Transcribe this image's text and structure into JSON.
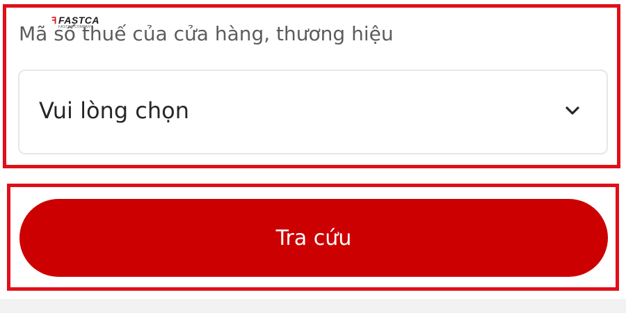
{
  "watermark": {
    "brand": "FASTCA",
    "tagline": "FASTCA COMPANY"
  },
  "form": {
    "label": "Mã số thuế của cửa hàng, thương hiệu",
    "select_value": "Vui lòng chọn",
    "select_icon": "chevron-down-icon"
  },
  "search_button": {
    "label": "Tra cứu"
  },
  "colors": {
    "accent": "#cc0000",
    "highlight_border": "#e0101a"
  }
}
